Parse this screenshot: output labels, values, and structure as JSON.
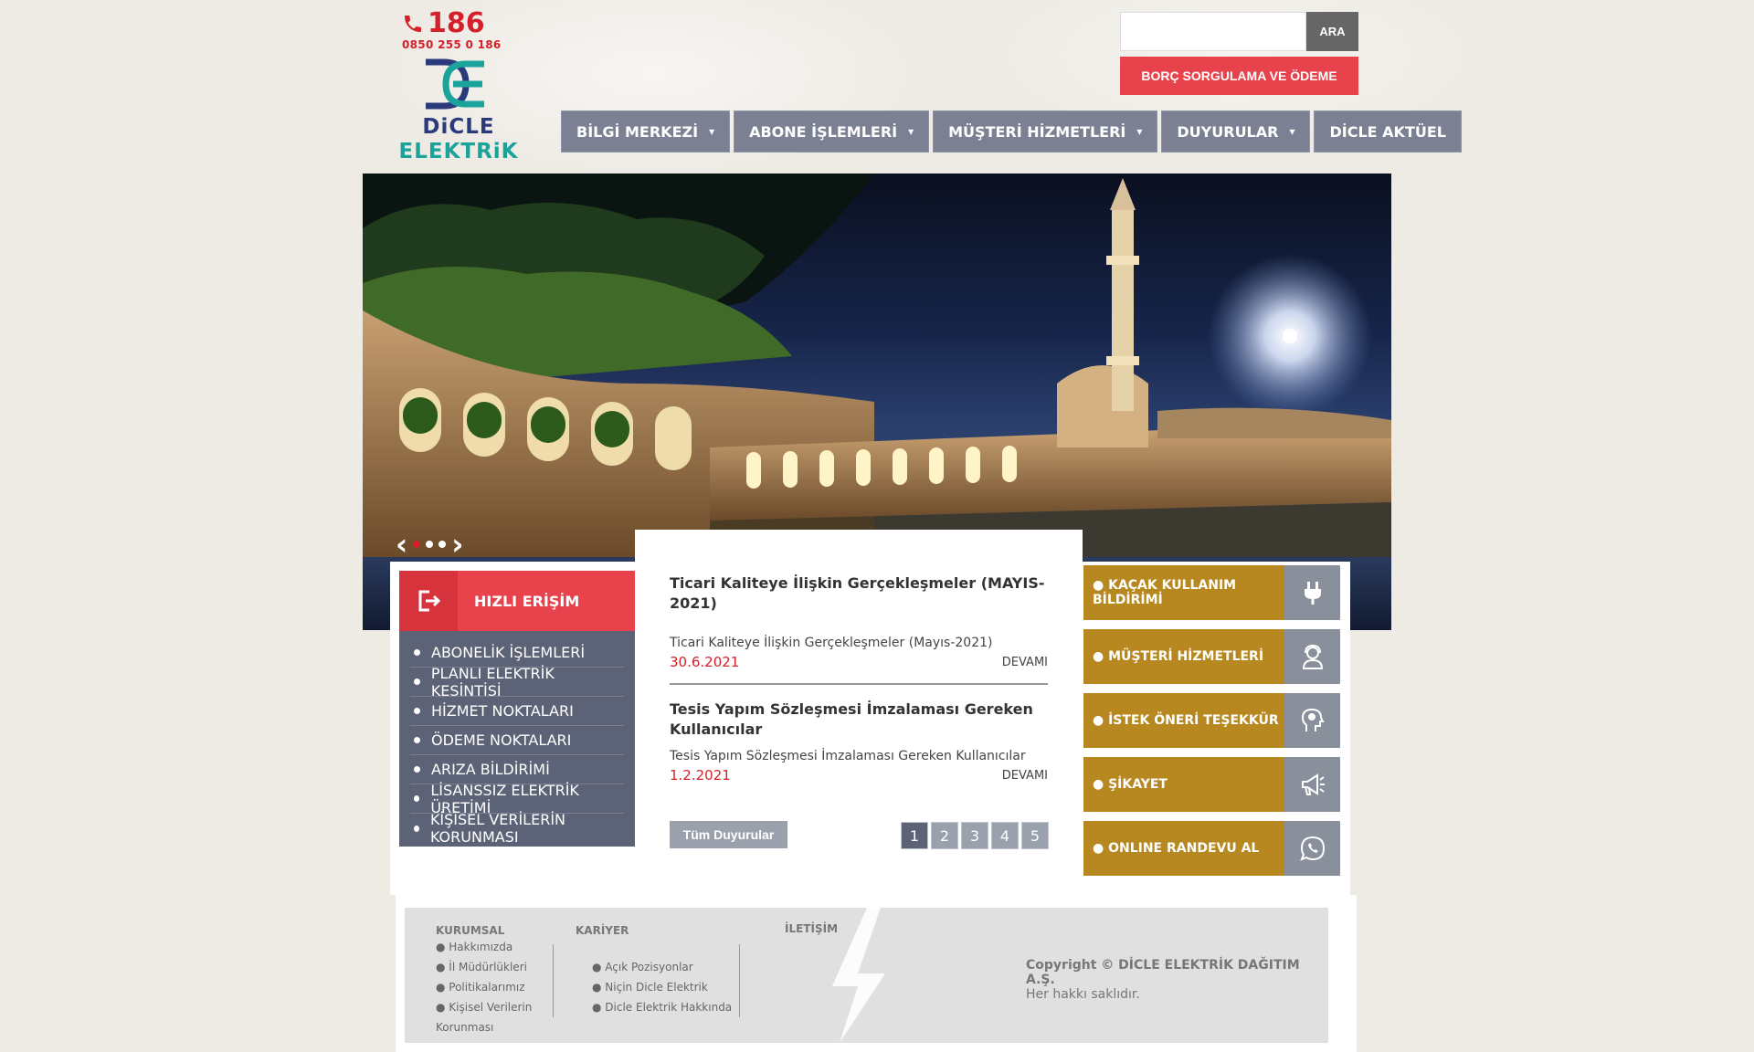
{
  "header": {
    "phone_short": "186",
    "phone_long": "0850 255 0 186",
    "logo_line1": "DiCLE",
    "logo_line2": "ELEKTRiK",
    "search_placeholder": "",
    "search_button": "ARA",
    "borc_button": "BORÇ SORGULAMA VE ÖDEME"
  },
  "nav": [
    {
      "label": "BİLGİ MERKEZİ",
      "has_caret": true
    },
    {
      "label": "ABONE İŞLEMLERİ",
      "has_caret": true
    },
    {
      "label": "MÜŞTERİ HİZMETLERİ",
      "has_caret": true
    },
    {
      "label": "DUYURULAR",
      "has_caret": true
    },
    {
      "label": "DİCLE AKTÜEL",
      "has_caret": false
    }
  ],
  "quick_access": {
    "title": "HIZLI ERİŞİM",
    "items": [
      "ABONELİK İŞLEMLERİ",
      "PLANLI ELEKTRİK KESİNTİSİ",
      "HİZMET NOKTALARI",
      "ÖDEME NOKTALARI",
      "ARIZA BİLDİRİMİ",
      "LİSANSSIZ ELEKTRİK ÜRETİMİ",
      "KİŞİSEL VERİLERİN KORUNMASI"
    ]
  },
  "news": {
    "items": [
      {
        "title": "Ticari Kaliteye İlişkin Gerçekleşmeler (MAYIS-2021)",
        "desc": "Ticari Kaliteye İlişkin Gerçekleşmeler (Mayıs-2021)",
        "date": "30.6.2021",
        "more": "DEVAMI"
      },
      {
        "title": "Tesis Yapım Sözleşmesi İmzalaması Gereken Kullanıcılar",
        "desc": "Tesis Yapım Sözleşmesi İmzalaması Gereken Kullanıcılar",
        "date": "1.2.2021",
        "more": "DEVAMI"
      }
    ],
    "all_button": "Tüm Duyurular",
    "pages": [
      "1",
      "2",
      "3",
      "4",
      "5"
    ],
    "active_page": "1"
  },
  "actions": [
    {
      "label": "● KAÇAK KULLANIM BİLDİRİMİ",
      "icon": "plug-icon"
    },
    {
      "label": "● MÜŞTERİ HİZMETLERİ",
      "icon": "operator-icon"
    },
    {
      "label": "● İSTEK ÖNERİ TEŞEKKÜR",
      "icon": "idea-head-icon"
    },
    {
      "label": "● ŞİKAYET",
      "icon": "megaphone-icon"
    },
    {
      "label": "● ONLINE RANDEVU AL",
      "icon": "whatsapp-icon"
    }
  ],
  "footer": {
    "kurumsal": {
      "title": "KURUMSAL",
      "items": [
        "● Hakkımızda",
        "● İl Müdürlükleri",
        "● Politikalarımız",
        "● Kişisel Verilerin",
        "Korunması"
      ]
    },
    "kariyer": {
      "title": "KARİYER",
      "items": [
        "● Açık Pozisyonlar",
        "● Niçin Dicle Elektrik",
        "● Dicle Elektrik Hakkında"
      ]
    },
    "iletisim": {
      "title": "İLETİŞİM"
    },
    "copyright_line1": "Copyright © DİCLE ELEKTRİK DAĞITIM A.Ş.",
    "copyright_line2": "Her hakkı saklıdır."
  },
  "colors": {
    "red": "#e8434d",
    "nav_gray": "#7b8192",
    "gold": "#b7881f",
    "dark_slate": "#5d6376"
  }
}
